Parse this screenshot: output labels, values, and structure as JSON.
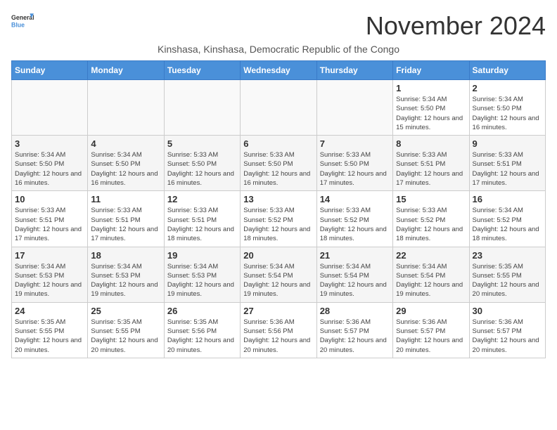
{
  "logo": {
    "line1": "General",
    "line2": "Blue"
  },
  "title": "November 2024",
  "subtitle": "Kinshasa, Kinshasa, Democratic Republic of the Congo",
  "days_of_week": [
    "Sunday",
    "Monday",
    "Tuesday",
    "Wednesday",
    "Thursday",
    "Friday",
    "Saturday"
  ],
  "weeks": [
    [
      {
        "day": "",
        "info": ""
      },
      {
        "day": "",
        "info": ""
      },
      {
        "day": "",
        "info": ""
      },
      {
        "day": "",
        "info": ""
      },
      {
        "day": "",
        "info": ""
      },
      {
        "day": "1",
        "info": "Sunrise: 5:34 AM\nSunset: 5:50 PM\nDaylight: 12 hours and 15 minutes."
      },
      {
        "day": "2",
        "info": "Sunrise: 5:34 AM\nSunset: 5:50 PM\nDaylight: 12 hours and 16 minutes."
      }
    ],
    [
      {
        "day": "3",
        "info": "Sunrise: 5:34 AM\nSunset: 5:50 PM\nDaylight: 12 hours and 16 minutes."
      },
      {
        "day": "4",
        "info": "Sunrise: 5:34 AM\nSunset: 5:50 PM\nDaylight: 12 hours and 16 minutes."
      },
      {
        "day": "5",
        "info": "Sunrise: 5:33 AM\nSunset: 5:50 PM\nDaylight: 12 hours and 16 minutes."
      },
      {
        "day": "6",
        "info": "Sunrise: 5:33 AM\nSunset: 5:50 PM\nDaylight: 12 hours and 16 minutes."
      },
      {
        "day": "7",
        "info": "Sunrise: 5:33 AM\nSunset: 5:50 PM\nDaylight: 12 hours and 17 minutes."
      },
      {
        "day": "8",
        "info": "Sunrise: 5:33 AM\nSunset: 5:51 PM\nDaylight: 12 hours and 17 minutes."
      },
      {
        "day": "9",
        "info": "Sunrise: 5:33 AM\nSunset: 5:51 PM\nDaylight: 12 hours and 17 minutes."
      }
    ],
    [
      {
        "day": "10",
        "info": "Sunrise: 5:33 AM\nSunset: 5:51 PM\nDaylight: 12 hours and 17 minutes."
      },
      {
        "day": "11",
        "info": "Sunrise: 5:33 AM\nSunset: 5:51 PM\nDaylight: 12 hours and 17 minutes."
      },
      {
        "day": "12",
        "info": "Sunrise: 5:33 AM\nSunset: 5:51 PM\nDaylight: 12 hours and 18 minutes."
      },
      {
        "day": "13",
        "info": "Sunrise: 5:33 AM\nSunset: 5:52 PM\nDaylight: 12 hours and 18 minutes."
      },
      {
        "day": "14",
        "info": "Sunrise: 5:33 AM\nSunset: 5:52 PM\nDaylight: 12 hours and 18 minutes."
      },
      {
        "day": "15",
        "info": "Sunrise: 5:33 AM\nSunset: 5:52 PM\nDaylight: 12 hours and 18 minutes."
      },
      {
        "day": "16",
        "info": "Sunrise: 5:34 AM\nSunset: 5:52 PM\nDaylight: 12 hours and 18 minutes."
      }
    ],
    [
      {
        "day": "17",
        "info": "Sunrise: 5:34 AM\nSunset: 5:53 PM\nDaylight: 12 hours and 19 minutes."
      },
      {
        "day": "18",
        "info": "Sunrise: 5:34 AM\nSunset: 5:53 PM\nDaylight: 12 hours and 19 minutes."
      },
      {
        "day": "19",
        "info": "Sunrise: 5:34 AM\nSunset: 5:53 PM\nDaylight: 12 hours and 19 minutes."
      },
      {
        "day": "20",
        "info": "Sunrise: 5:34 AM\nSunset: 5:54 PM\nDaylight: 12 hours and 19 minutes."
      },
      {
        "day": "21",
        "info": "Sunrise: 5:34 AM\nSunset: 5:54 PM\nDaylight: 12 hours and 19 minutes."
      },
      {
        "day": "22",
        "info": "Sunrise: 5:34 AM\nSunset: 5:54 PM\nDaylight: 12 hours and 19 minutes."
      },
      {
        "day": "23",
        "info": "Sunrise: 5:35 AM\nSunset: 5:55 PM\nDaylight: 12 hours and 20 minutes."
      }
    ],
    [
      {
        "day": "24",
        "info": "Sunrise: 5:35 AM\nSunset: 5:55 PM\nDaylight: 12 hours and 20 minutes."
      },
      {
        "day": "25",
        "info": "Sunrise: 5:35 AM\nSunset: 5:55 PM\nDaylight: 12 hours and 20 minutes."
      },
      {
        "day": "26",
        "info": "Sunrise: 5:35 AM\nSunset: 5:56 PM\nDaylight: 12 hours and 20 minutes."
      },
      {
        "day": "27",
        "info": "Sunrise: 5:36 AM\nSunset: 5:56 PM\nDaylight: 12 hours and 20 minutes."
      },
      {
        "day": "28",
        "info": "Sunrise: 5:36 AM\nSunset: 5:57 PM\nDaylight: 12 hours and 20 minutes."
      },
      {
        "day": "29",
        "info": "Sunrise: 5:36 AM\nSunset: 5:57 PM\nDaylight: 12 hours and 20 minutes."
      },
      {
        "day": "30",
        "info": "Sunrise: 5:36 AM\nSunset: 5:57 PM\nDaylight: 12 hours and 20 minutes."
      }
    ]
  ]
}
